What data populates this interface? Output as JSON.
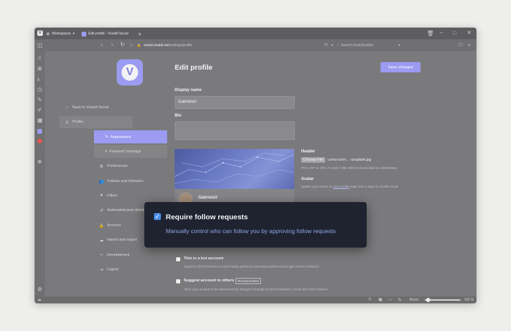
{
  "browser": {
    "workspace_label": "Workspaces",
    "tab_title": "Edit profile - Vivaldi Social",
    "new_tab": "+",
    "url_host": "social.vivaldi.net",
    "url_path": "/settings/profile",
    "search_placeholder": "Search DuckDuckGo",
    "zoom_label": "Reset",
    "zoom_value": "100 %"
  },
  "nav": {
    "back": "Back to Vivaldi Social",
    "profile": "Profile",
    "appearance": "Appearance",
    "featured": "Featured hashtags",
    "preferences": "Preferences",
    "follows": "Follows and followers",
    "filters": "Filters",
    "automated": "Automated post deletion",
    "account": "Account",
    "import": "Import and export",
    "development": "Development",
    "logout": "Logout"
  },
  "page": {
    "title": "Edit profile",
    "save": "Save changes",
    "display_name_label": "Display name",
    "display_name_value": "GabrielaV",
    "bio_label": "Bio",
    "header_label": "Header",
    "choose_file": "Choose File",
    "file_name": "conny-schn... -unsplash.jpg",
    "header_hint": "PNG, GIF or JPG. At most 2 MB. Will be downscaled to 1500x500px",
    "avatar_label": "Avatar",
    "avatar_hint_pre": "Update your avatar on",
    "avatar_hint_link": "your profile",
    "avatar_hint_post": "page and re-login to Vivaldi Social",
    "preview_name": "GabrielaV",
    "bot_label": "This is a bot account",
    "bot_hint": "Signal to others that the account mainly performs automated actions and might not be monitored",
    "suggest_label": "Suggest account to others",
    "suggest_badge": "Recommended",
    "suggest_hint": "Allow your account to be discovered by strangers through recommendations, trends and other features"
  },
  "tooltip": {
    "title": "Require follow requests",
    "subtitle": "Manually control who can follow you by approving follow requests",
    "checked": true
  },
  "colors": {
    "accent": "#9b9bf2",
    "tooltip_bg": "#1f2330",
    "tooltip_text": "#8fa6e6"
  }
}
